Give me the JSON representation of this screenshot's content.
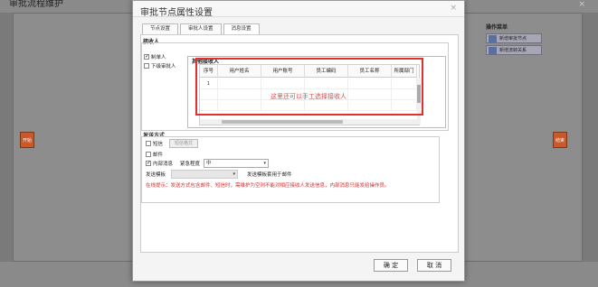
{
  "background": {
    "title": "审批流程维护",
    "close": "×",
    "start_node": "开始",
    "end_node": "结束",
    "ops_title": "操作菜单",
    "ops": [
      "新增审批节点",
      "新增流转关系"
    ]
  },
  "dialog": {
    "title": "审批节点属性设置",
    "close": "×",
    "tabs": [
      "节点设置",
      "审批人设置",
      "消息设置"
    ],
    "active_tab": 2,
    "receivers": {
      "section_title": "接收人",
      "self_label": "制单人",
      "self_checked": true,
      "superior_label": "下级审批人",
      "superior_checked": false,
      "other_title": "其他接收人",
      "columns": [
        "序号",
        "用户姓名",
        "用户账号",
        "员工编码",
        "员工名称",
        "所属部门"
      ],
      "rows": [
        [
          "1",
          "",
          "",
          "",
          "",
          ""
        ],
        [
          "",
          "",
          "",
          "",
          "",
          ""
        ],
        [
          "",
          "",
          "",
          "",
          "",
          ""
        ],
        [
          "",
          "",
          "",
          "",
          "",
          ""
        ]
      ],
      "hint": "这里还可以手工选择接收人"
    },
    "send": {
      "section_title": "发送方式",
      "sms_label": "短信",
      "sms_checked": false,
      "sms_format_button": "短信格式",
      "mail_label": "邮件",
      "mail_checked": false,
      "internal_label": "内部消息",
      "internal_checked": true,
      "urgency_label": "紧急程度",
      "urgency_value": "中",
      "template_label": "发送模板",
      "template_value": "",
      "template_note": "发送模板套用于邮件",
      "warning": "在线提示：发送方式包含邮件、短信时，需维护为空则不能对相应接收人发送信息，内部消息只能发给操作员。"
    },
    "ok_button": "确 定",
    "cancel_button": "取 消"
  }
}
